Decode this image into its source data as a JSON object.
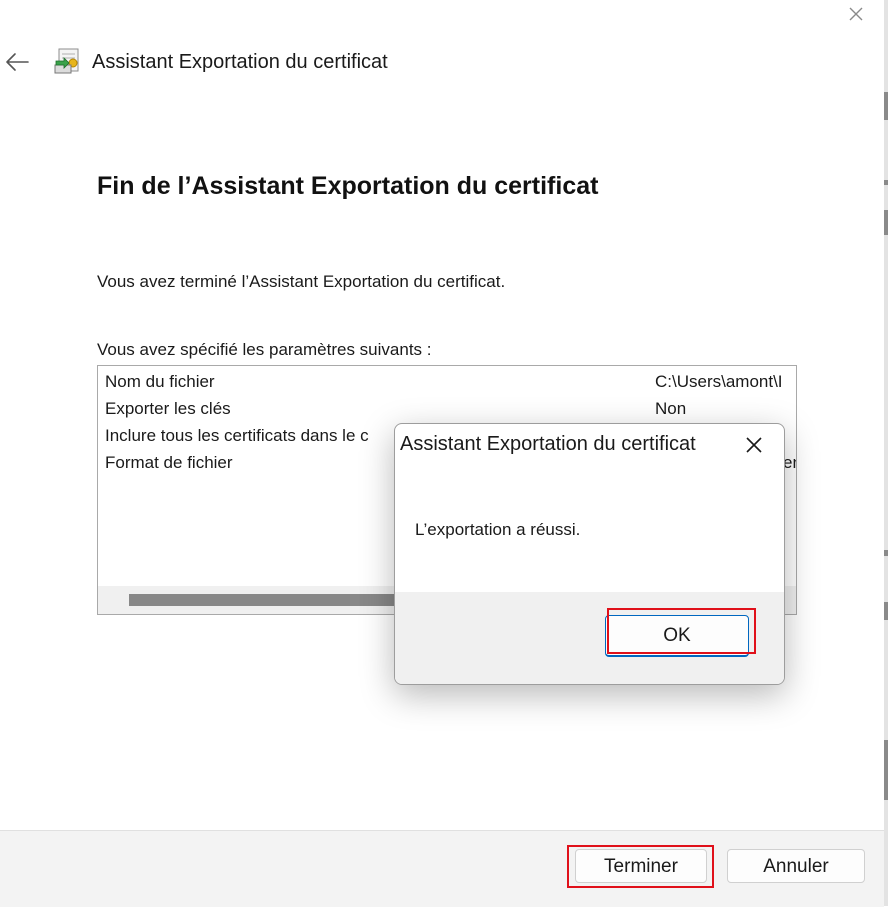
{
  "window": {
    "title": "Assistant Exportation du certificat",
    "close_icon": "close-icon",
    "back_icon": "back-arrow-icon",
    "app_icon": "certificate-export-icon"
  },
  "page": {
    "heading": "Fin de l’Assistant Exportation du certificat",
    "done_text": "Vous avez terminé l’Assistant Exportation du certificat.",
    "params_label": "Vous avez spécifié les paramètres suivants :"
  },
  "settings": [
    {
      "key": "Nom du fichier",
      "value": "C:\\Users\\amont\\I"
    },
    {
      "key": "Exporter les clés",
      "value": "Non"
    },
    {
      "key": "Inclure tous les certificats dans le c",
      "value": ""
    },
    {
      "key": "Format de fichier",
      "value": "en"
    }
  ],
  "footer": {
    "finish_label": "Terminer",
    "cancel_label": "Annuler"
  },
  "dialog": {
    "title": "Assistant Exportation du certificat",
    "message": "L’exportation a réussi.",
    "ok_label": "OK"
  },
  "colors": {
    "highlight": "#e0101a",
    "accent": "#0067c0"
  }
}
